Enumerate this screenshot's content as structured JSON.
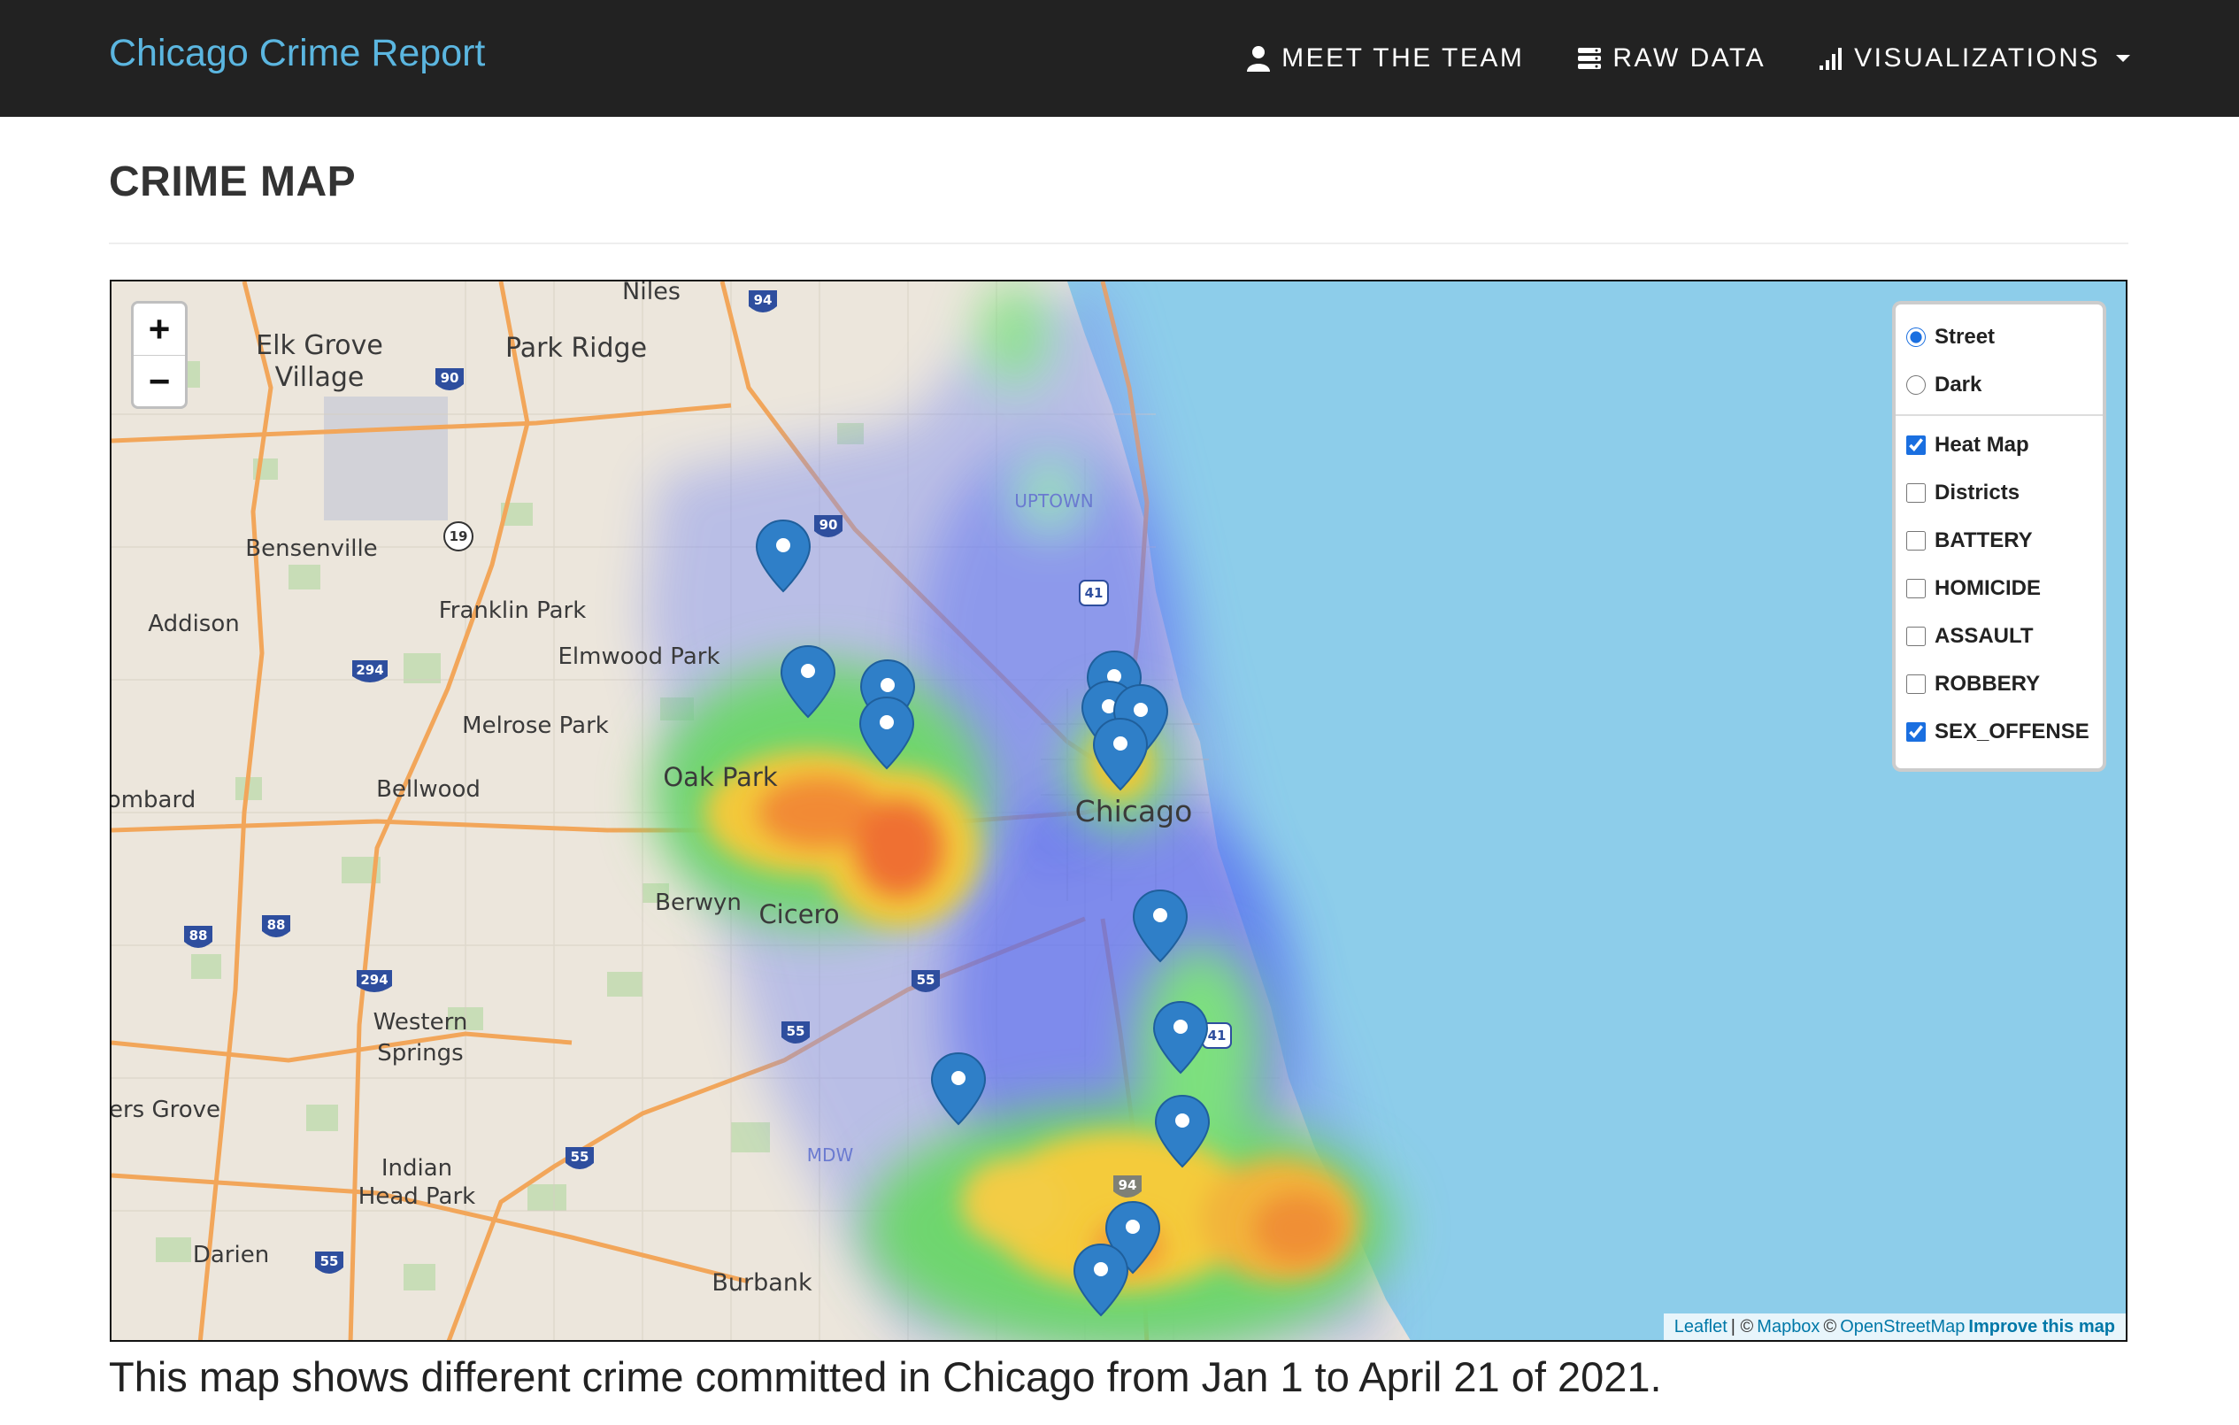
{
  "navbar": {
    "brand": "Chicago Crime Report",
    "links": [
      {
        "label": "MEET THE TEAM",
        "icon": "user-icon"
      },
      {
        "label": "RAW DATA",
        "icon": "database-icon"
      },
      {
        "label": "VISUALIZATIONS",
        "icon": "bar-chart-icon",
        "dropdown": true
      }
    ]
  },
  "page": {
    "title": "CRIME MAP",
    "caption": "This map shows different crime committed in Chicago from Jan 1 to April 21 of 2021."
  },
  "map": {
    "zoom_in": "+",
    "zoom_out": "−",
    "base_layers": [
      {
        "label": "Street",
        "checked": true
      },
      {
        "label": "Dark",
        "checked": false
      }
    ],
    "overlays": [
      {
        "label": "Heat Map",
        "checked": true
      },
      {
        "label": "Districts",
        "checked": false
      },
      {
        "label": "BATTERY",
        "checked": false
      },
      {
        "label": "HOMICIDE",
        "checked": false
      },
      {
        "label": "ASSAULT",
        "checked": false
      },
      {
        "label": "ROBBERY",
        "checked": false
      },
      {
        "label": "SEX_OFFENSE",
        "checked": true
      }
    ],
    "attribution": {
      "leaflet": "Leaflet",
      "sep": "| ©",
      "mapbox": "Mapbox",
      "copy": "©",
      "osm": "OpenStreetMap",
      "improve": "Improve this map"
    },
    "place_labels": [
      "Niles",
      "Elk Grove",
      "Village",
      "Park Ridge",
      "Bensenville",
      "Addison",
      "Franklin Park",
      "Elmwood Park",
      "Melrose Park",
      "Bellwood",
      "Oak Park",
      "Chicago",
      "Berwyn",
      "Cicero",
      "ombard",
      "Western",
      "Springs",
      "ers Grove",
      "Indian",
      "Head Park",
      "Darien",
      "Burbank",
      "UPTOWN",
      "MDW"
    ],
    "highway_shields": [
      "94",
      "90",
      "19",
      "294",
      "90",
      "41",
      "88",
      "88",
      "294",
      "55",
      "55",
      "55",
      "41",
      "55",
      "94"
    ],
    "colors": {
      "water": "#8dcdea",
      "land": "#ece6dc",
      "marker": "#2f7fc8",
      "accent": "#1a6fe0"
    }
  }
}
